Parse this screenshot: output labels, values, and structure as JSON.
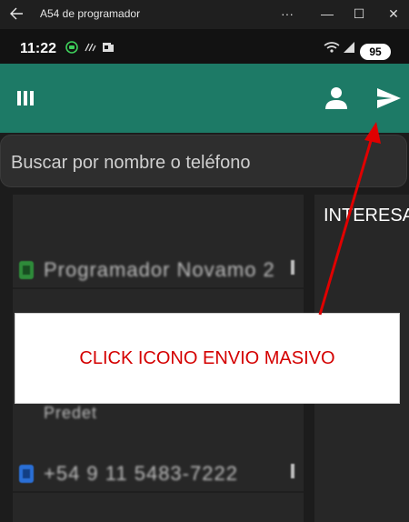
{
  "window": {
    "title": "A54 de programador",
    "minimize": "—",
    "maximize": "☐",
    "close": "✕",
    "more": "···"
  },
  "statusbar": {
    "time": "11:22",
    "battery": "95"
  },
  "appbar": {
    "menu_icon": "columns-icon",
    "contact_icon": "person-icon",
    "send_icon": "send-icon",
    "color": "#1d7a66"
  },
  "search": {
    "placeholder": "Buscar por nombre o teléfono"
  },
  "contacts": [
    {
      "name": "Programador Novamo 2",
      "badge_color": "#2e8b3a"
    },
    {
      "name": "Predet",
      "badge_color": "#7a7a7a"
    },
    {
      "name": "+54 9 11 5483-7222",
      "badge_color": "#2a6fd6"
    }
  ],
  "right_panel": {
    "label": "INTERESA"
  },
  "annotation": {
    "text": "CLICK ICONO ENVIO MASIVO",
    "color": "#d40000"
  }
}
